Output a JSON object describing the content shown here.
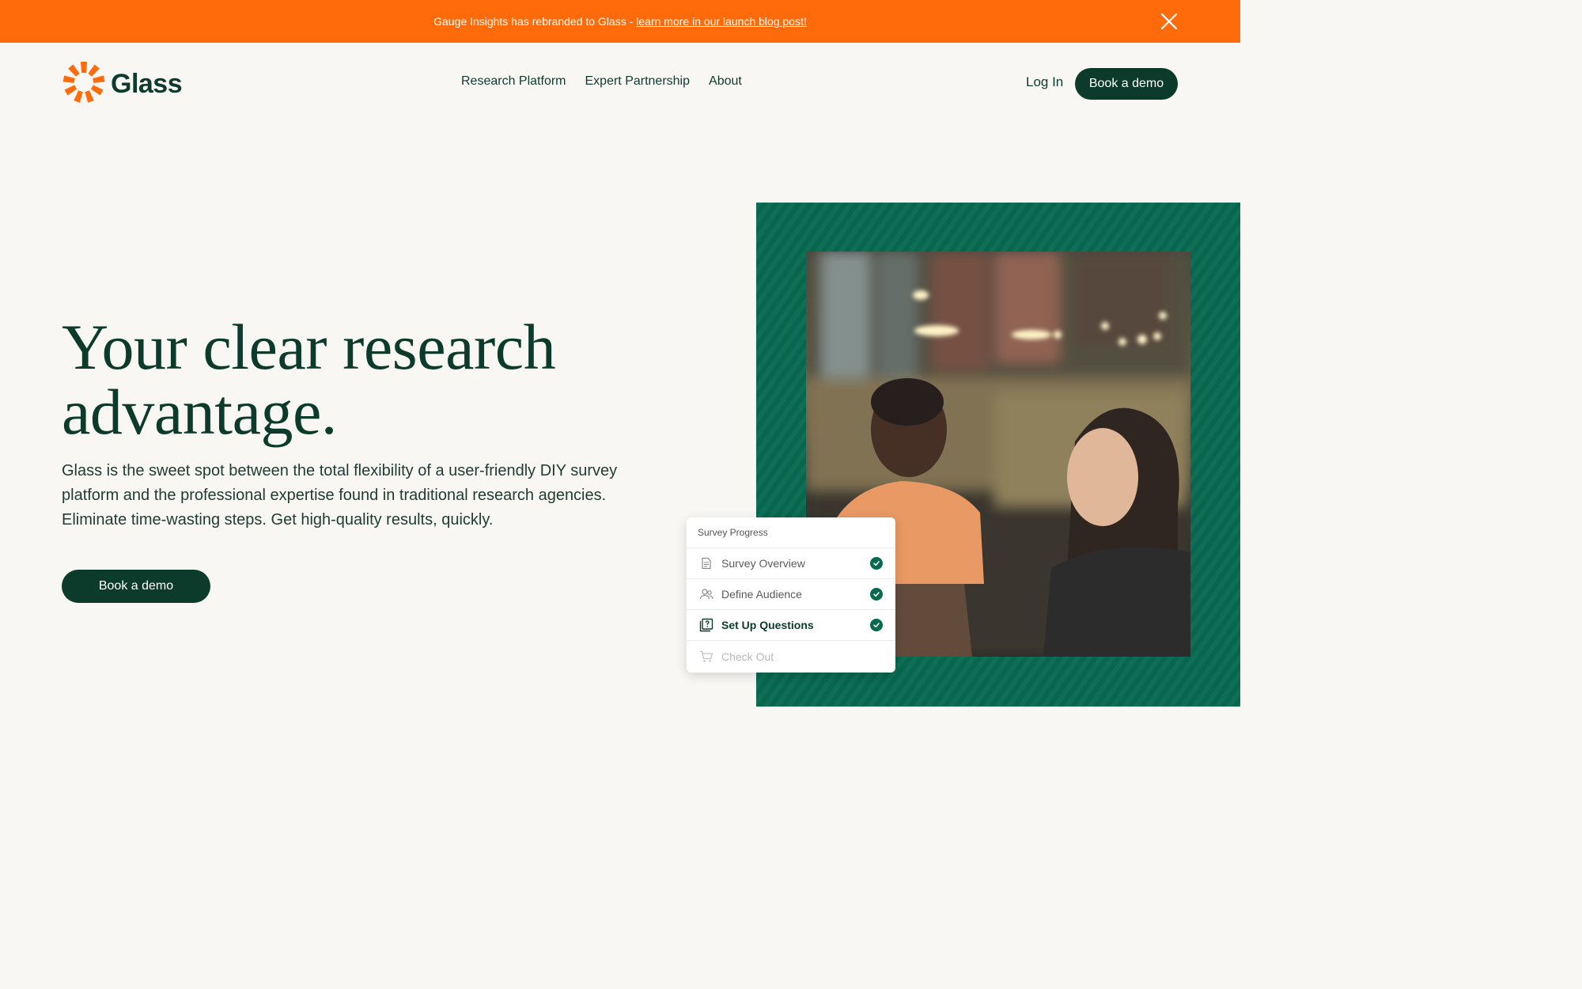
{
  "banner": {
    "text": "Gauge Insights has rebranded to Glass -",
    "link": "learn more in our launch blog post!",
    "close_icon": "close-icon",
    "bg_color": "#ff6b0a"
  },
  "nav": {
    "logo_text": "Glass",
    "logo_icon": "sunburst-logo",
    "links": [
      "Research Platform",
      "Expert Partnership",
      "About"
    ],
    "login": "Log In",
    "demo_button": "Book a demo"
  },
  "hero": {
    "title_line1": "Your clear research",
    "title_line2": "advantage.",
    "subtitle": "Glass is the sweet spot between the total flexibility of a user-friendly DIY survey platform and the professional expertise found in traditional research agencies. Eliminate time-wasting steps. Get high-quality results, quickly.",
    "demo_button": "Book a demo"
  },
  "survey_card": {
    "title": "Survey Progress",
    "steps": [
      {
        "label": "Survey Overview",
        "icon": "document-icon",
        "state": "complete"
      },
      {
        "label": "Define Audience",
        "icon": "users-icon",
        "state": "complete"
      },
      {
        "label": "Set Up Questions",
        "icon": "question-icon",
        "state": "active-complete"
      },
      {
        "label": "Check Out",
        "icon": "cart-icon",
        "state": "disabled"
      }
    ]
  },
  "colors": {
    "brand_dark": "#0c3a2b",
    "brand_green": "#07694f",
    "accent_orange": "#ff6b0a",
    "page_bg": "#f8f7f4"
  }
}
